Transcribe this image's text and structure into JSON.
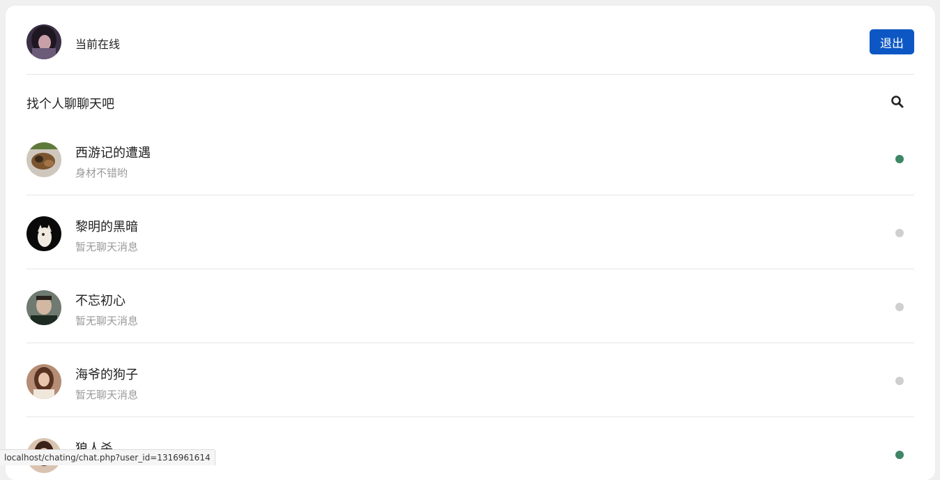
{
  "header": {
    "status_label": "当前在线",
    "logout_label": "退出"
  },
  "search": {
    "label": "找个人聊聊天吧",
    "icon": "search-icon"
  },
  "users": [
    {
      "name": "西游记的遭遇",
      "message": "身材不错哟",
      "online": true
    },
    {
      "name": "黎明的黑暗",
      "message": "暂无聊天消息",
      "online": false
    },
    {
      "name": "不忘初心",
      "message": "暂无聊天消息",
      "online": false
    },
    {
      "name": "海爷的狗子",
      "message": "暂无聊天消息",
      "online": false
    },
    {
      "name": "狼人杀",
      "message": "",
      "online": true
    }
  ],
  "status_bar": {
    "url": "localhost/chating/chat.php?user_id=1316961614"
  },
  "colors": {
    "online": "#3f8568",
    "offline": "#cfcfcf",
    "primary": "#0d57c5"
  }
}
